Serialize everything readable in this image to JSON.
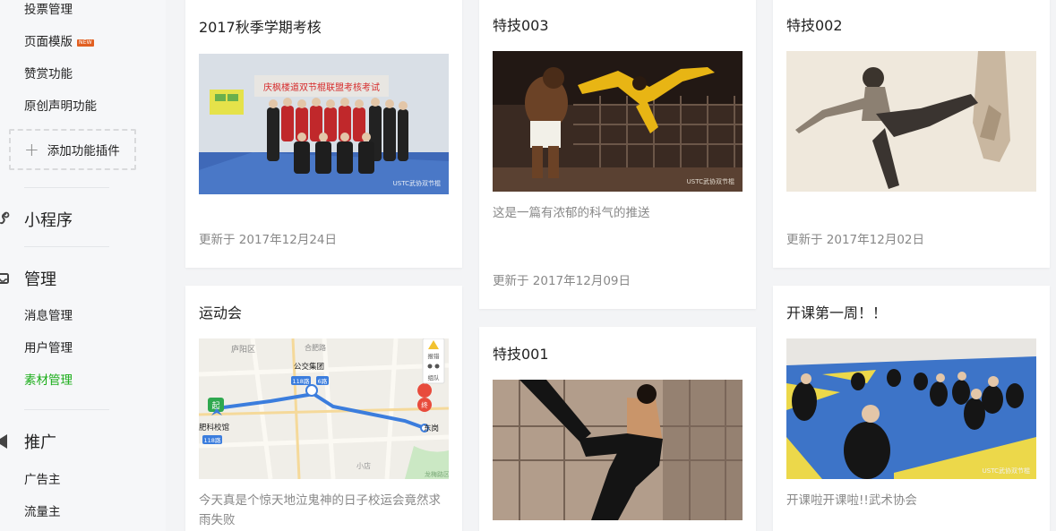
{
  "sidebar": {
    "functions": {
      "items": [
        {
          "label": "投票管理"
        },
        {
          "label": "页面模版",
          "badge": "NEW"
        },
        {
          "label": "赞赏功能"
        },
        {
          "label": "原创声明功能"
        }
      ],
      "add_plugin_label": "添加功能插件"
    },
    "mini_program": {
      "title": "小程序",
      "icon": "mini-program-icon"
    },
    "manage": {
      "title": "管理",
      "icon": "manage-icon",
      "items": [
        {
          "label": "消息管理"
        },
        {
          "label": "用户管理"
        },
        {
          "label": "素材管理",
          "active": true
        }
      ]
    },
    "promote": {
      "title": "推广",
      "icon": "promote-icon",
      "items": [
        {
          "label": "广告主"
        },
        {
          "label": "流量主"
        }
      ]
    }
  },
  "cards": [
    {
      "title": "2017秋季学期考核",
      "date": "更新于 2017年12月24日",
      "desc": "",
      "image": "group-photo"
    },
    {
      "title": "特技003",
      "desc": "这是一篇有浓郁的科气的推送",
      "date": "更新于 2017年12月09日",
      "image": "flying-kick"
    },
    {
      "title": "特技002",
      "date": "更新于 2017年12月02日",
      "desc": "",
      "image": "side-kick"
    },
    {
      "title": "运动会",
      "desc": "今天真是个惊天地泣鬼神的日子校运会竟然求雨失败",
      "date": "",
      "image": "map"
    },
    {
      "title": "特技001",
      "desc": "",
      "date": "",
      "image": "spin-kick"
    },
    {
      "title": "开课第一周！！",
      "desc": "开课啦开课啦!!武术协会",
      "date": "",
      "image": "class"
    }
  ],
  "image_text": {
    "banner": "庆枫楼道双节棍联盟考核考试",
    "watermark_1": "USTC武协双节棍",
    "watermark_2": "USTC武协双节棍",
    "watermark_3": "USTC武协双节棍",
    "map_labels": {
      "district": "庐阳区",
      "road_1": "合肥路",
      "bus_group": "公交集团",
      "tag_118": "118路",
      "tag_6": "6路",
      "start": "起",
      "end": "终",
      "place_start": "肥科校馆",
      "place_end": "东岗",
      "tag_118b": "118路",
      "small": "小店",
      "report": "报错",
      "team": "组队",
      "corner": "龙梅路区"
    }
  },
  "colors": {
    "accent": "#1aad19",
    "badge": "#e15f21",
    "card_bg": "#ffffff",
    "page_bg": "#f3f4f6"
  }
}
